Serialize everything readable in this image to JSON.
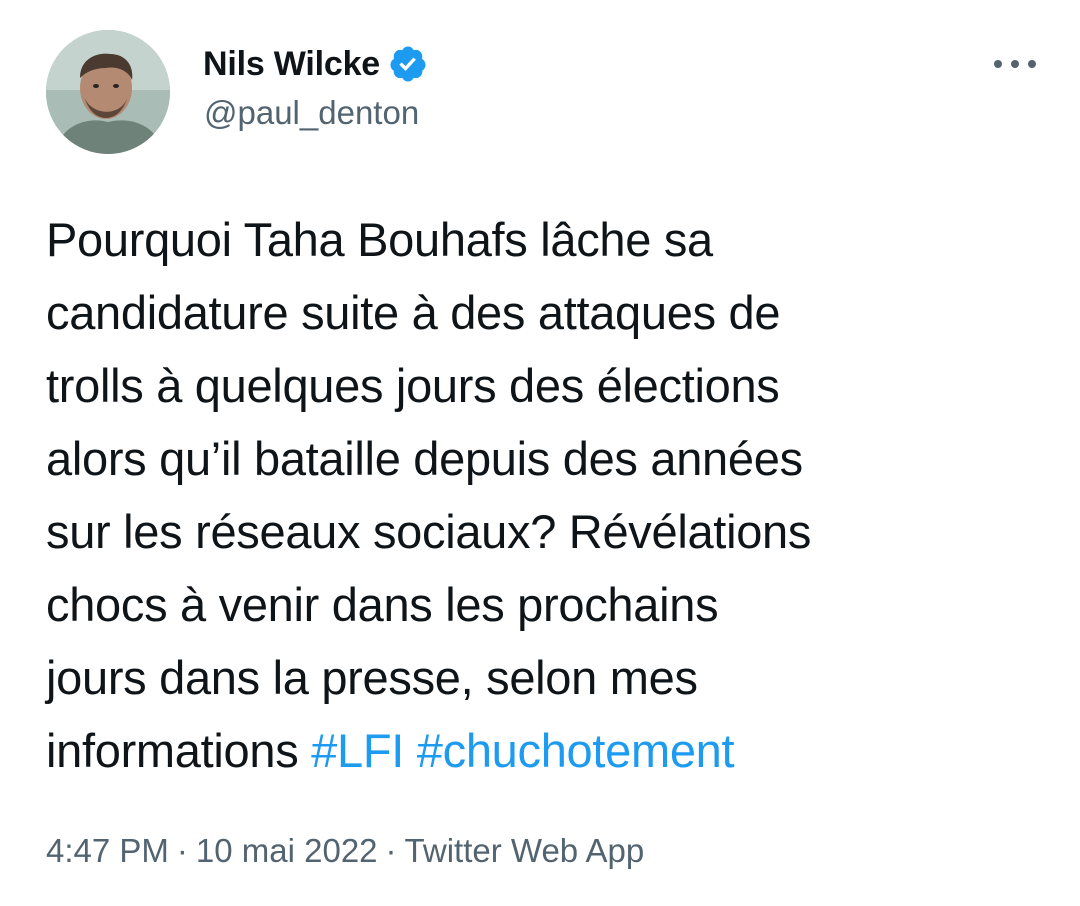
{
  "author": {
    "display_name": "Nils Wilcke",
    "handle": "@paul_denton",
    "verified_icon": "verified-badge-icon",
    "avatar_icon": "profile-photo"
  },
  "more_icon": "more-horizontal-icon",
  "tweet": {
    "lines": [
      "Pourquoi Taha Bouhafs lâche sa",
      "candidature suite à des attaques de",
      "trolls à quelques jours des élections",
      "alors qu’il bataille depuis des années",
      "sur les réseaux sociaux? Révélations",
      "chocs à venir dans les prochains",
      "jours dans la presse, selon mes"
    ],
    "last_line_text": "informations",
    "hashtags": [
      "#LFI",
      "#chuchotement"
    ]
  },
  "meta": {
    "time": "4:47 PM",
    "separator": "·",
    "date": "10 mai 2022",
    "source": "Twitter Web App"
  },
  "colors": {
    "text": "#0f1419",
    "secondary": "#536471",
    "link": "#1d9bf0",
    "verified": "#1d9bf0"
  }
}
